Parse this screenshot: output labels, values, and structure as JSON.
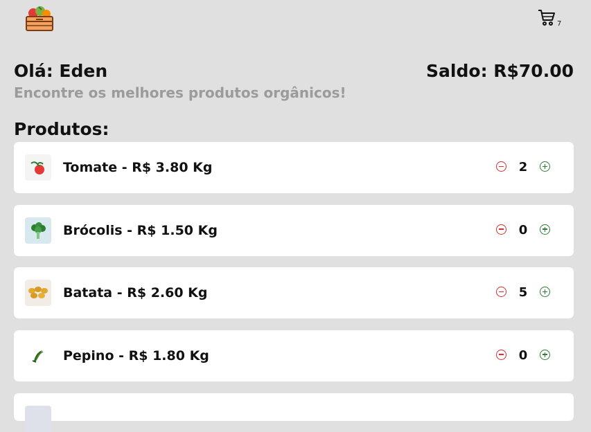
{
  "header": {
    "logo_icon": "vegetable-crate-logo",
    "cart_icon": "shopping-cart-icon",
    "cart_count": "7"
  },
  "greeting": "Olá: Eden",
  "balance": "Saldo: R$70.00",
  "subtitle": "Encontre os melhores produtos orgânicos!",
  "section_title": "Produtos:",
  "products": [
    {
      "label": "Tomate - R$ 3.80 Kg",
      "qty": "2",
      "icon": "tomato-icon"
    },
    {
      "label": "Brócolis - R$ 1.50 Kg",
      "qty": "0",
      "icon": "broccoli-icon"
    },
    {
      "label": "Batata - R$ 2.60 Kg",
      "qty": "5",
      "icon": "potato-icon"
    },
    {
      "label": "Pepino - R$ 1.80 Kg",
      "qty": "0",
      "icon": "cucumber-icon"
    }
  ],
  "colors": {
    "minus": "#d32f2f",
    "plus": "#2e7d32",
    "background": "#e0e0e0"
  }
}
